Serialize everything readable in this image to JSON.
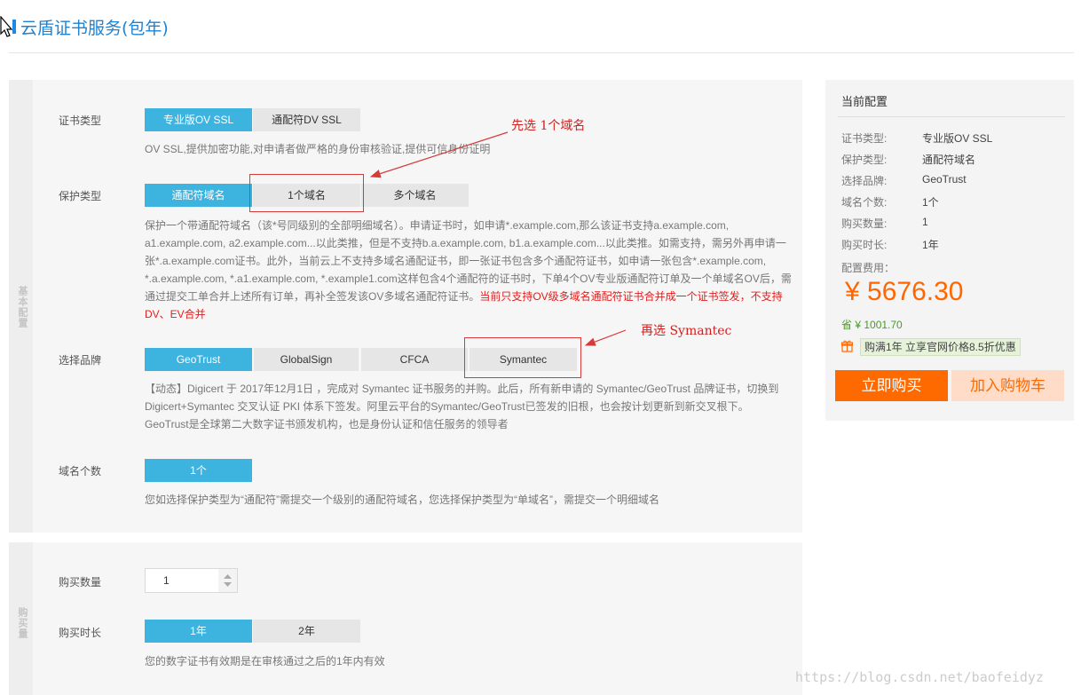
{
  "header": {
    "title": "云盾证书服务(包年)"
  },
  "sections": {
    "basic": "基本配置",
    "buy": "购买量"
  },
  "cert_type": {
    "label": "证书类型",
    "options": [
      "专业版OV SSL",
      "通配符DV SSL"
    ],
    "desc": "OV SSL,提供加密功能,对申请者做严格的身份审核验证,提供可信身份证明"
  },
  "protect_type": {
    "label": "保护类型",
    "options": [
      "通配符域名",
      "1个域名",
      "多个域名"
    ],
    "desc_lines": [
      "保护一个带通配符域名（该*号同级别的全部明细域名）。申请证书时，如申请*.example.com,那么该证书支持a.example.com,",
      "a1.example.com, a2.example.com...以此类推，但是不支持b.a.example.com, b1.a.example.com...以此类推。如需支持，需另外再申请一",
      "张*.a.example.com证书。此外，当前云上不支持多域名通配证书，即一张证书包含多个通配符证书，如申请一张包含*.example.com,",
      "*.a.example.com, *.a1.example.com, *.example1.com这样包含4个通配符的证书时，下单4个OV专业版通配符订单及一个单域名OV后，需",
      "通过提交工单合并上述所有订单，再补全签发该OV多域名通配符证书。"
    ],
    "desc_red_1": "当前只支持OV级多域名通配符证书合并成一个证书签发，不支持",
    "desc_red_2": "DV、EV合并"
  },
  "brand": {
    "label": "选择品牌",
    "options": [
      "GeoTrust",
      "GlobalSign",
      "CFCA",
      "Symantec"
    ],
    "desc_lines": [
      "【动态】Digicert 于 2017年12月1日 ，完成对 Symantec 证书服务的并购。此后，所有新申请的 Symantec/GeoTrust 品牌证书，切换到",
      "Digicert+Symantec 交叉认证 PKI 体系下签发。阿里云平台的Symantec/GeoTrust已签发的旧根，也会按计划更新到新交叉根下。",
      "GeoTrust是全球第二大数字证书颁发机构，也是身份认证和信任服务的领导者"
    ]
  },
  "domain_count": {
    "label": "域名个数",
    "value": "1个",
    "desc": "您如选择保护类型为“通配符”需提交一个级别的通配符域名，您选择保护类型为“单域名”，需提交一个明细域名"
  },
  "quantity": {
    "label": "购买数量",
    "value": "1"
  },
  "duration": {
    "label": "购买时长",
    "options": [
      "1年",
      "2年"
    ],
    "desc": "您的数字证书有效期是在审核通过之后的1年内有效"
  },
  "annotations": {
    "first": "先选 1个域名",
    "second": "再选 Symantec"
  },
  "summary": {
    "title": "当前配置",
    "rows": [
      {
        "k": "证书类型:",
        "v": "专业版OV SSL"
      },
      {
        "k": "保护类型:",
        "v": "通配符域名"
      },
      {
        "k": "选择品牌:",
        "v": "GeoTrust"
      },
      {
        "k": "域名个数:",
        "v": "1个"
      },
      {
        "k": "购买数量:",
        "v": "1"
      },
      {
        "k": "购买时长:",
        "v": "1年"
      }
    ],
    "fee_label": "配置费用：",
    "price": "¥ 5676.30",
    "save": "省 ¥ 1001.70",
    "promo": "购满1年 立享官网价格8.5折优惠",
    "buy_button": "立即购买",
    "cart_button": "加入购物车"
  },
  "watermark": "https://blog.csdn.net/baofeidyz",
  "colors": {
    "selected": "#3db3e0",
    "accent": "#ff6a00",
    "annotation": "#d02020",
    "title": "#1f82d2"
  }
}
